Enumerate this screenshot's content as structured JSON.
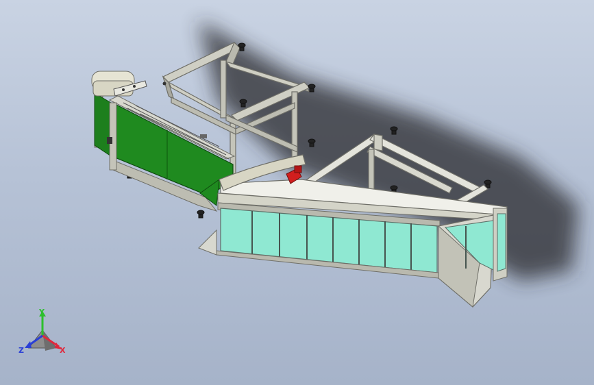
{
  "viewport": {
    "background_top": "#c9d3e3",
    "background_bottom": "#a6b3c9"
  },
  "model": {
    "colors": {
      "frame": "#cfcfc4",
      "frame_shadow": "#8d8d84",
      "panel_green": "#1d7f1d",
      "panel_glass": "#8fe8d2",
      "accent_red": "#d11e1e",
      "shadow": "#2a2a2e"
    }
  },
  "triad": {
    "y_label": "Y",
    "x_label": "X",
    "z_label": "Z",
    "y_color": "#2dbf2d",
    "x_color": "#e0283c",
    "z_color": "#2a3fd6"
  }
}
